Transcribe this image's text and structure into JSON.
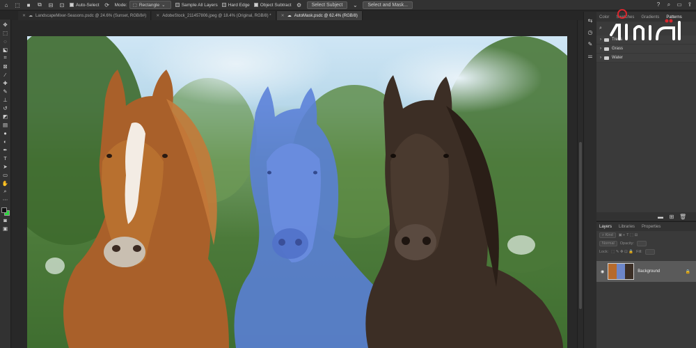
{
  "options_bar": {
    "auto_select_label": "Auto-Select",
    "mode_label": "Mode:",
    "mode_value": "Rectangle",
    "sample_all_layers": "Sample All Layers",
    "hard_edge": "Hard Edge",
    "object_subtract": "Object Subtract",
    "select_subject": "Select Subject",
    "select_and_mask": "Select and Mask..."
  },
  "tabs": [
    {
      "label": "LandscapeMixer-Seasons.psdc @ 24.6% (Sunset, RGB/8#)",
      "active": false
    },
    {
      "label": "AdobeStock_211457806.jpeg @ 18.4% (Original, RGB/8) *",
      "active": false
    },
    {
      "label": "AutoMask.psdc @ 62.4% (RGB/8)",
      "active": true
    }
  ],
  "panel_top": {
    "tabs": [
      "Color",
      "Swatches",
      "Gradients",
      "Patterns"
    ],
    "items": [
      "Trees",
      "Grass",
      "Water"
    ]
  },
  "layers_panel": {
    "tabs": [
      "Layers",
      "Libraries",
      "Properties"
    ],
    "kind_label": "Kind",
    "blend_mode": "Normal",
    "opacity_label": "Opacity:",
    "lock_label": "Lock:",
    "fill_label": "Fill:",
    "layer_name": "Background"
  },
  "watermark": {
    "text": "آموزش"
  },
  "colors": {
    "foreground": "#111111",
    "background": "#2bd43c",
    "mask_overlay": "#5a7fd8",
    "watermark": "#d7262d"
  }
}
